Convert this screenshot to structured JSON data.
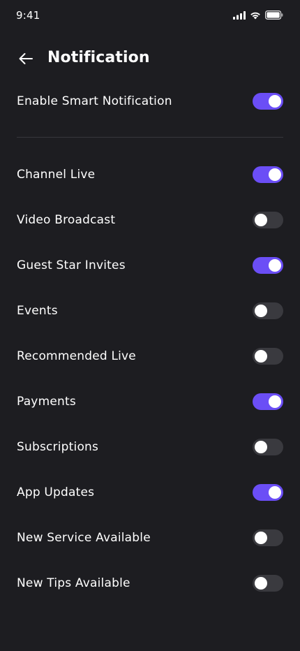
{
  "status_bar": {
    "time": "9:41",
    "icons": [
      "cellular-signal-icon",
      "wifi-icon",
      "battery-icon"
    ]
  },
  "header": {
    "back_icon": "arrow-left-icon",
    "title": "Notification"
  },
  "smart_notification": {
    "label": "Enable Smart Notification",
    "enabled": true
  },
  "settings": [
    {
      "label": "Channel Live",
      "enabled": true
    },
    {
      "label": "Video Broadcast",
      "enabled": false
    },
    {
      "label": "Guest Star Invites",
      "enabled": true
    },
    {
      "label": "Events",
      "enabled": false
    },
    {
      "label": "Recommended Live",
      "enabled": false
    },
    {
      "label": "Payments",
      "enabled": true
    },
    {
      "label": "Subscriptions",
      "enabled": false
    },
    {
      "label": "App Updates",
      "enabled": true
    },
    {
      "label": "New Service Available",
      "enabled": false
    },
    {
      "label": "New Tips Available",
      "enabled": false
    }
  ],
  "colors": {
    "background": "#1d1d21",
    "accent": "#6b4ef6",
    "toggle_off": "#3a3a3f",
    "divider": "#38383d"
  }
}
